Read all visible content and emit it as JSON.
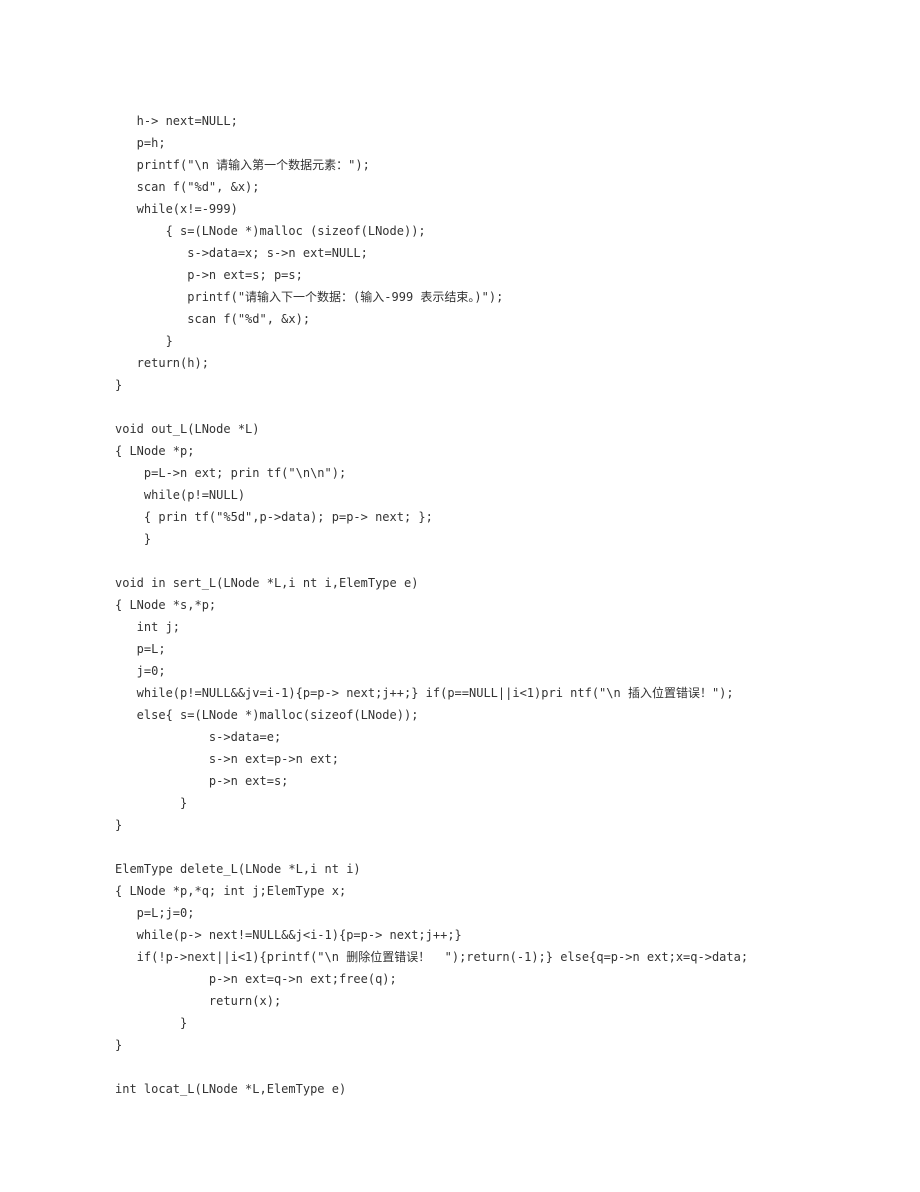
{
  "code_lines": [
    "   h-> next=NULL;",
    "   p=h;",
    "   printf(\"\\n 请输入第一个数据元素：\");",
    "   scan f(\"%d\", &x);",
    "   while(x!=-999)",
    "       { s=(LNode *)malloc (sizeof(LNode));",
    "          s->data=x; s->n ext=NULL;",
    "          p->n ext=s; p=s;",
    "          printf(\"请输入下一个数据：(输入-999 表示结束。)\");",
    "          scan f(\"%d\", &x);",
    "       }",
    "   return(h);",
    "}",
    "",
    "void out_L(LNode *L)",
    "{ LNode *p;",
    "    p=L->n ext; prin tf(\"\\n\\n\");",
    "    while(p!=NULL)",
    "    { prin tf(\"%5d\",p->data); p=p-> next; };",
    "    }",
    "",
    "void in sert_L(LNode *L,i nt i,ElemType e)",
    "{ LNode *s,*p;",
    "   int j;",
    "   p=L;",
    "   j=0;",
    "   while(p!=NULL&&jv=i-1){p=p-> next;j++;} if(p==NULL||i<1)pri ntf(\"\\n 插入位置错误！\");",
    "   else{ s=(LNode *)malloc(sizeof(LNode));",
    "             s->data=e;",
    "             s->n ext=p->n ext;",
    "             p->n ext=s;",
    "         }",
    "}",
    "",
    "ElemType delete_L(LNode *L,i nt i)",
    "{ LNode *p,*q; int j;ElemType x;",
    "   p=L;j=0;",
    "   while(p-> next!=NULL&&j<i-1){p=p-> next;j++;}",
    "   if(!p->next||i<1){printf(\"\\n 删除位置错误！  \");return(-1);} else{q=p->n ext;x=q->data;",
    "             p->n ext=q->n ext;free(q);",
    "             return(x);",
    "         }",
    "}",
    "",
    "int locat_L(LNode *L,ElemType e)"
  ]
}
